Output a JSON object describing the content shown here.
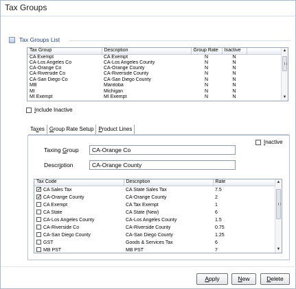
{
  "window": {
    "title": "Tax Groups"
  },
  "section": {
    "label": "Tax Groups List",
    "icon": "list-icon"
  },
  "groups_grid": {
    "columns": [
      "Tax Group",
      "Description",
      "Group Rate",
      "Inactive"
    ],
    "rows": [
      [
        "CA Exempt",
        "CA Exempt",
        "N",
        "N"
      ],
      [
        "CA-Los Angeles Co",
        "CA-Los Angeles County",
        "N",
        "N"
      ],
      [
        "CA-Orange Co",
        "CA-Orange County",
        "N",
        "N"
      ],
      [
        "CA-Riverside Co",
        "CA-Riverside County",
        "N",
        "N"
      ],
      [
        "CA-San Diego Co",
        "CA-San Diego County",
        "N",
        "N"
      ],
      [
        "MB",
        "Manitoba",
        "N",
        "N"
      ],
      [
        "MI",
        "Michigan",
        "N",
        "N"
      ],
      [
        "MI Exempt",
        "MI Exempt",
        "N",
        "N"
      ]
    ]
  },
  "include_inactive": {
    "prefix": "I",
    "rest": "nclude Inactive",
    "checked": false
  },
  "tabs": [
    {
      "pre": "Ta",
      "key": "x",
      "post": "es",
      "active": true
    },
    {
      "pre": "",
      "key": "G",
      "post": "roup Rate Setup",
      "active": false
    },
    {
      "pre": "",
      "key": "P",
      "post": "roduct Lines",
      "active": false
    }
  ],
  "form": {
    "taxing_group_label_pre": "Taxing ",
    "taxing_group_label_key": "G",
    "taxing_group_label_post": "roup",
    "taxing_group_value": "CA-Orange Co",
    "description_label_pre": "Descr",
    "description_label_key": "i",
    "description_label_post": "ption",
    "description_value": "CA-Orange County",
    "inactive_key": "I",
    "inactive_rest": "nactive",
    "inactive_checked": false
  },
  "codes_grid": {
    "columns": [
      "Tax Code",
      "Description",
      "Rate"
    ],
    "rows": [
      {
        "checked": true,
        "code": "CA Sales Tax",
        "desc": "CA State Sales Tax",
        "rate": "7.5"
      },
      {
        "checked": true,
        "code": "CA-Orange County",
        "desc": "CA-Orange County",
        "rate": "2"
      },
      {
        "checked": false,
        "code": "CA Exempt",
        "desc": "CA Tax Exempt",
        "rate": "1"
      },
      {
        "checked": false,
        "code": "CA State",
        "desc": "CA State (New)",
        "rate": "6"
      },
      {
        "checked": false,
        "code": "CA-Los Angeles County",
        "desc": "CA-Los Angeles County",
        "rate": "1.5"
      },
      {
        "checked": false,
        "code": "CA-Riverside Co",
        "desc": "CA-Riverside County",
        "rate": "0.75"
      },
      {
        "checked": false,
        "code": "CA-San Diego County",
        "desc": "CA-San Diego County",
        "rate": "1.25"
      },
      {
        "checked": false,
        "code": "GST",
        "desc": "Goods & Services Tax",
        "rate": "6"
      },
      {
        "checked": false,
        "code": "MB PST",
        "desc": "MB PST",
        "rate": "7"
      }
    ]
  },
  "buttons": {
    "apply_key": "A",
    "apply_rest": "pply",
    "new_key": "N",
    "new_rest": "ew",
    "delete_key": "D",
    "delete_rest": "elete"
  }
}
